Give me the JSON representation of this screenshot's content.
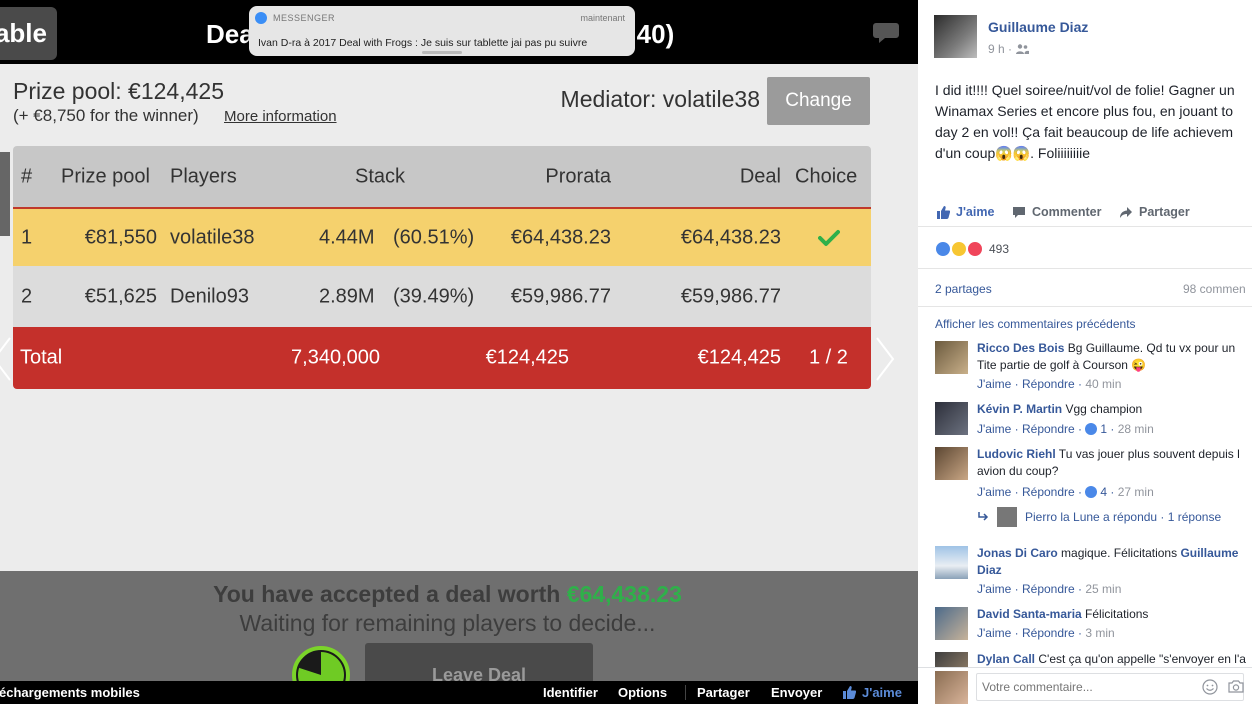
{
  "poker": {
    "table_button": "able",
    "title_left": "Dea",
    "title_right": ":40)",
    "notification": {
      "app": "MESSENGER",
      "time": "maintenant",
      "message": "Ivan D-ra à 2017 Deal with Frogs : Je suis sur tablette jai pas pu suivre"
    },
    "prize_pool": "Prize pool: €124,425",
    "prize_sub": "(+ €8,750 for the winner)",
    "more_info": "More information",
    "mediator": "Mediator: volatile38",
    "change_label": "Change",
    "table": {
      "headers": {
        "num": "#",
        "prize": "Prize pool",
        "players": "Players",
        "stack": "Stack",
        "prorata": "Prorata",
        "deal": "Deal",
        "choice": "Choice"
      },
      "rows": [
        {
          "num": "1",
          "prize": "€81,550",
          "player": "volatile38",
          "stack": "4.44M",
          "pct": "(60.51%)",
          "prorata": "€64,438.23",
          "deal": "€64,438.23",
          "choice": "check"
        },
        {
          "num": "2",
          "prize": "€51,625",
          "player": "Denilo93",
          "stack": "2.89M",
          "pct": "(39.49%)",
          "prorata": "€59,986.77",
          "deal": "€59,986.77",
          "choice": ""
        }
      ],
      "total": {
        "label": "Total",
        "stack": "7,340,000",
        "prorata": "€124,425",
        "deal": "€124,425",
        "choice": "1 / 2"
      }
    },
    "accepted_prefix": "You have accepted a deal worth ",
    "accepted_amount": "€64,438.23",
    "waiting": "Waiting for remaining players to decide...",
    "leave_label": "Leave Deal",
    "timer_fraction": 0.8,
    "accent_red": "#c4302b",
    "highlight_yellow": "#f5d16d",
    "check_green": "#2fb04a"
  },
  "fb_bar": {
    "left_text": "échargements mobiles",
    "identify": "Identifier",
    "options": "Options",
    "share": "Partager",
    "send": "Envoyer",
    "like": "J'aime"
  },
  "sidebar": {
    "author": "Guillaume Diaz",
    "time": "9 h ·",
    "post_text": "I did it!!!! Quel soiree/nuit/vol de folie! Gagner un\nWinamax Series et encore plus fou, en jouant to\nday 2 en vol!! Ça fait beaucoup de life achievem\nd'un coup😱😱. Foliiiiiiiie",
    "actions": {
      "like": "J'aime",
      "comment": "Commenter",
      "share": "Partager"
    },
    "reaction_count": "493",
    "shares": "2 partages",
    "comments_count": "98 commen",
    "prev_comments": "Afficher les commentaires précédents",
    "comments": [
      {
        "name": "Ricco Des Bois",
        "text": " Bg Guillaume. Qd tu vx pour un\nTite partie de golf à Courson 😜",
        "like": "J'aime",
        "reply": "Répondre",
        "likes": "",
        "time": "40 min"
      },
      {
        "name": "Kévin P. Martin",
        "text": " Vgg champion",
        "like": "J'aime",
        "reply": "Répondre",
        "likes": "1",
        "time": "28 min"
      },
      {
        "name": "Ludovic Riehl",
        "text": " Tu vas jouer plus souvent depuis l\navion du coup?",
        "like": "J'aime",
        "reply": "Répondre",
        "likes": "4",
        "time": "27 min"
      },
      {
        "name": "Jonas Di Caro",
        "text": " magique. Félicitations ",
        "mention": "Guillaume\nDiaz",
        "like": "J'aime",
        "reply": "Répondre",
        "likes": "",
        "time": "25 min"
      },
      {
        "name": "David Santa-maria",
        "text": " Félicitations",
        "like": "J'aime",
        "reply": "Répondre",
        "likes": "",
        "time": "3 min"
      },
      {
        "name": "Dylan Call",
        "text": " C'est ça qu'on appelle \"s'envoyer en l'a"
      }
    ],
    "reply_summary": "Pierro la Lune a répondu · 1 réponse",
    "write_placeholder": "Votre commentaire...",
    "link_blue": "#365899"
  }
}
